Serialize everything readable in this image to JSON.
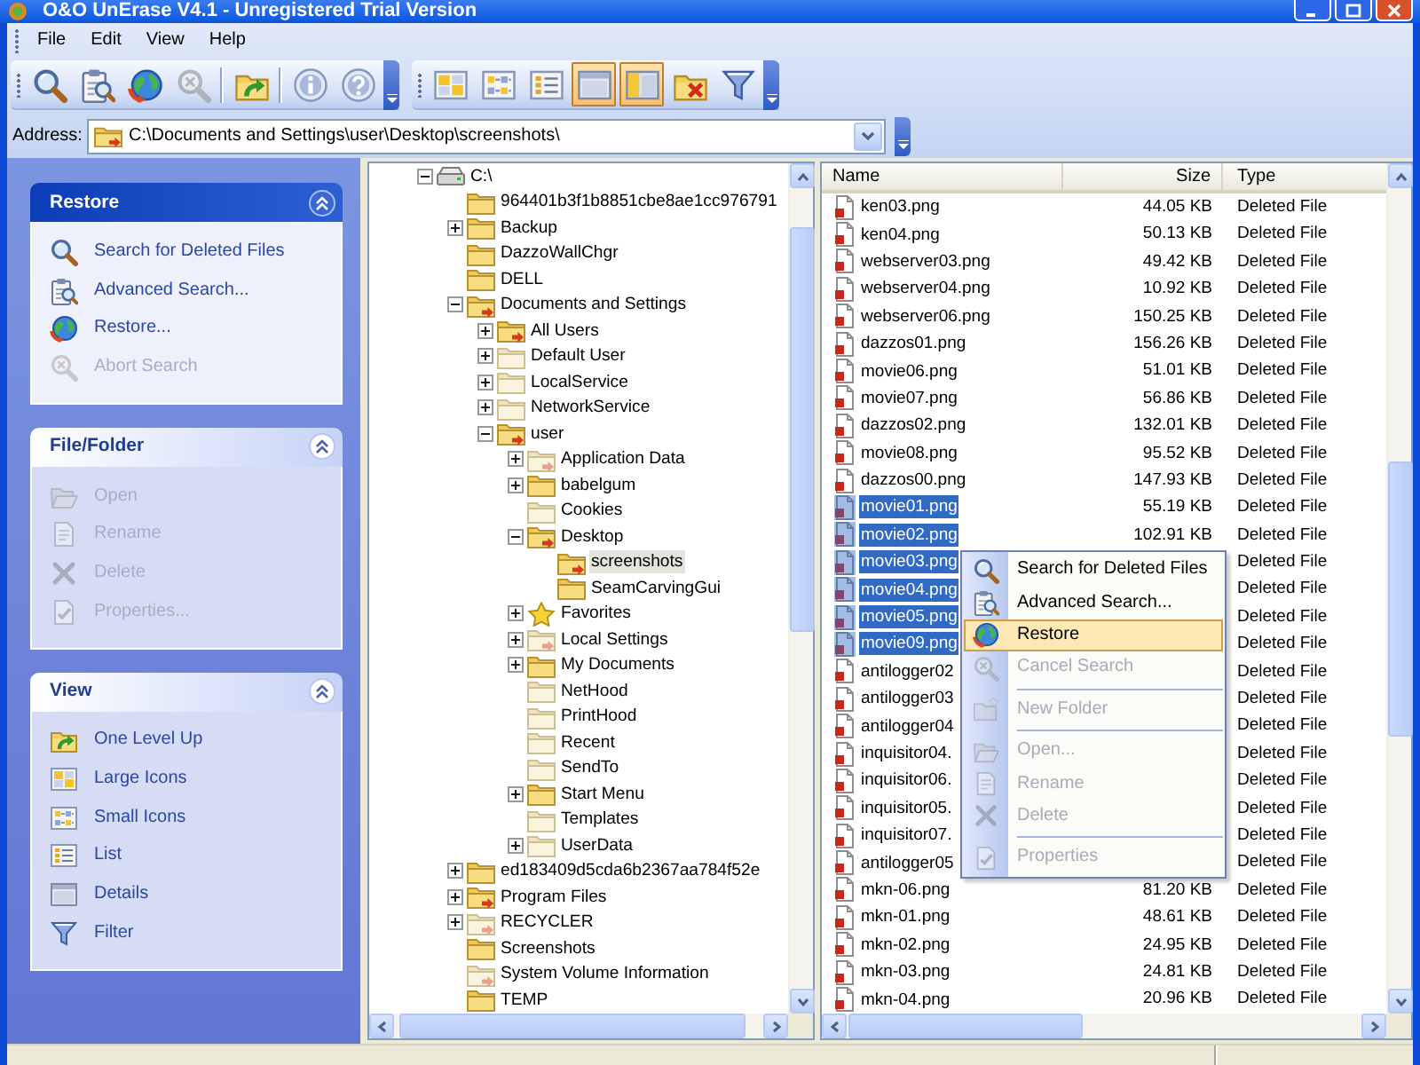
{
  "window": {
    "title": "O&O UnErase V4.1 - Unregistered Trial Version"
  },
  "menu_bar": [
    "File",
    "Edit",
    "View",
    "Help"
  ],
  "toolbars": [
    {
      "buttons": [
        {
          "kind": "button",
          "pressed": false,
          "disabled": false
        },
        {
          "kind": "button",
          "pressed": false,
          "disabled": false
        },
        {
          "kind": "button",
          "pressed": false,
          "disabled": false
        },
        {
          "kind": "button",
          "pressed": false,
          "disabled": true
        },
        {
          "kind": "separator"
        },
        {
          "kind": "button",
          "pressed": false,
          "disabled": false
        },
        {
          "kind": "separator"
        },
        {
          "kind": "button",
          "pressed": false,
          "disabled": false
        },
        {
          "kind": "button",
          "pressed": false,
          "disabled": false
        }
      ]
    },
    {
      "buttons": [
        {
          "kind": "button",
          "pressed": false,
          "disabled": false
        },
        {
          "kind": "button",
          "pressed": false,
          "disabled": false
        },
        {
          "kind": "button",
          "pressed": false,
          "disabled": false
        },
        {
          "kind": "button",
          "pressed": true,
          "disabled": false
        },
        {
          "kind": "button",
          "pressed": true,
          "disabled": false
        },
        {
          "kind": "button",
          "pressed": false,
          "disabled": false
        },
        {
          "kind": "button",
          "pressed": false,
          "disabled": false
        }
      ]
    }
  ],
  "address_bar": {
    "label": "Address:",
    "value": "C:\\Documents and Settings\\user\\Desktop\\screenshots\\"
  },
  "task_panels": [
    {
      "title": "Restore",
      "emphasized": true,
      "expanded": true,
      "items": [
        {
          "label": "Search for Deleted Files",
          "disabled": false
        },
        {
          "label": "Advanced Search...",
          "disabled": false
        },
        {
          "label": "Restore...",
          "disabled": false
        },
        {
          "label": "Abort Search",
          "disabled": true
        }
      ]
    },
    {
      "title": "File/Folder",
      "emphasized": false,
      "expanded": true,
      "items": [
        {
          "label": "Open",
          "disabled": true
        },
        {
          "label": "Rename",
          "disabled": true
        },
        {
          "label": "Delete",
          "disabled": true
        },
        {
          "label": "Properties...",
          "disabled": true
        }
      ]
    },
    {
      "title": "View",
      "emphasized": false,
      "expanded": true,
      "items": [
        {
          "label": "One Level Up",
          "disabled": false
        },
        {
          "label": "Large Icons",
          "disabled": false
        },
        {
          "label": "Small Icons",
          "disabled": false
        },
        {
          "label": "List",
          "disabled": false
        },
        {
          "label": "Details",
          "disabled": false
        },
        {
          "label": "Filter",
          "disabled": false
        }
      ]
    }
  ],
  "folder_tree": [
    {
      "label": "C:\\",
      "kind": "drive",
      "expanded": true,
      "selected": false,
      "children": [
        {
          "label": "964401b3f1b8851cbe8ae1cc976791",
          "kind": "folder",
          "selected": false
        },
        {
          "label": "Backup",
          "kind": "folder",
          "expanded": false,
          "selected": false
        },
        {
          "label": "DazzoWallChgr",
          "kind": "folder",
          "selected": false
        },
        {
          "label": "DELL",
          "kind": "folder",
          "selected": false
        },
        {
          "label": "Documents and Settings",
          "kind": "folder-marked",
          "expanded": true,
          "selected": false,
          "children": [
            {
              "label": "All Users",
              "kind": "folder-marked",
              "expanded": false,
              "selected": false
            },
            {
              "label": "Default User",
              "kind": "folder-pale",
              "expanded": false,
              "selected": false
            },
            {
              "label": "LocalService",
              "kind": "folder-pale",
              "expanded": false,
              "selected": false
            },
            {
              "label": "NetworkService",
              "kind": "folder-pale",
              "expanded": false,
              "selected": false
            },
            {
              "label": "user",
              "kind": "folder-marked",
              "expanded": true,
              "selected": false,
              "children": [
                {
                  "label": "Application Data",
                  "kind": "folder-pale-marked",
                  "expanded": false,
                  "selected": false
                },
                {
                  "label": "babelgum",
                  "kind": "folder",
                  "expanded": false,
                  "selected": false
                },
                {
                  "label": "Cookies",
                  "kind": "folder-pale",
                  "selected": false
                },
                {
                  "label": "Desktop",
                  "kind": "folder-marked",
                  "expanded": true,
                  "selected": false,
                  "children": [
                    {
                      "label": "screenshots",
                      "kind": "folder-marked",
                      "selected": true
                    },
                    {
                      "label": "SeamCarvingGui",
                      "kind": "folder",
                      "selected": false
                    }
                  ]
                },
                {
                  "label": "Favorites",
                  "kind": "star",
                  "expanded": false,
                  "selected": false
                },
                {
                  "label": "Local Settings",
                  "kind": "folder-pale-marked",
                  "expanded": false,
                  "selected": false
                },
                {
                  "label": "My Documents",
                  "kind": "folder",
                  "expanded": false,
                  "selected": false
                },
                {
                  "label": "NetHood",
                  "kind": "folder-pale",
                  "selected": false
                },
                {
                  "label": "PrintHood",
                  "kind": "folder-pale",
                  "selected": false
                },
                {
                  "label": "Recent",
                  "kind": "folder-pale",
                  "selected": false
                },
                {
                  "label": "SendTo",
                  "kind": "folder-pale",
                  "selected": false
                },
                {
                  "label": "Start Menu",
                  "kind": "folder",
                  "expanded": false,
                  "selected": false
                },
                {
                  "label": "Templates",
                  "kind": "folder-pale",
                  "selected": false
                },
                {
                  "label": "UserData",
                  "kind": "folder-pale",
                  "expanded": false,
                  "selected": false
                }
              ]
            }
          ]
        },
        {
          "label": "ed183409d5cda6b2367aa784f52e",
          "kind": "folder",
          "expanded": false,
          "selected": false
        },
        {
          "label": "Program Files",
          "kind": "folder-marked",
          "expanded": false,
          "selected": false
        },
        {
          "label": "RECYCLER",
          "kind": "folder-pale-marked",
          "expanded": false,
          "selected": false
        },
        {
          "label": "Screenshots",
          "kind": "folder",
          "selected": false
        },
        {
          "label": "System Volume Information",
          "kind": "folder-pale-marked",
          "selected": false
        },
        {
          "label": "TEMP",
          "kind": "folder",
          "selected": false
        }
      ]
    }
  ],
  "file_list": {
    "columns": [
      "Name",
      "Size",
      "Type"
    ],
    "rows": [
      {
        "name": "ken03.png",
        "size": "44.05 KB",
        "type": "Deleted File",
        "selected": false
      },
      {
        "name": "ken04.png",
        "size": "50.13 KB",
        "type": "Deleted File",
        "selected": false
      },
      {
        "name": "webserver03.png",
        "size": "49.42 KB",
        "type": "Deleted File",
        "selected": false
      },
      {
        "name": "webserver04.png",
        "size": "10.92 KB",
        "type": "Deleted File",
        "selected": false
      },
      {
        "name": "webserver06.png",
        "size": "150.25 KB",
        "type": "Deleted File",
        "selected": false
      },
      {
        "name": "dazzos01.png",
        "size": "156.26 KB",
        "type": "Deleted File",
        "selected": false
      },
      {
        "name": "movie06.png",
        "size": "51.01 KB",
        "type": "Deleted File",
        "selected": false
      },
      {
        "name": "movie07.png",
        "size": "56.86 KB",
        "type": "Deleted File",
        "selected": false
      },
      {
        "name": "dazzos02.png",
        "size": "132.01 KB",
        "type": "Deleted File",
        "selected": false
      },
      {
        "name": "movie08.png",
        "size": "95.52 KB",
        "type": "Deleted File",
        "selected": false
      },
      {
        "name": "dazzos00.png",
        "size": "147.93 KB",
        "type": "Deleted File",
        "selected": false
      },
      {
        "name": "movie01.png",
        "size": "55.19 KB",
        "type": "Deleted File",
        "selected": true
      },
      {
        "name": "movie02.png",
        "size": "102.91 KB",
        "type": "Deleted File",
        "selected": true
      },
      {
        "name": "movie03.png",
        "type": "Deleted File",
        "selected": true
      },
      {
        "name": "movie04.png",
        "type": "Deleted File",
        "selected": true
      },
      {
        "name": "movie05.png",
        "type": "Deleted File",
        "selected": true
      },
      {
        "name": "movie09.png",
        "type": "Deleted File",
        "selected": true
      },
      {
        "name": "antilogger02",
        "type": "Deleted File",
        "selected": false
      },
      {
        "name": "antilogger03",
        "type": "Deleted File",
        "selected": false
      },
      {
        "name": "antilogger04",
        "type": "Deleted File",
        "selected": false
      },
      {
        "name": "inquisitor04.",
        "type": "Deleted File",
        "selected": false
      },
      {
        "name": "inquisitor06.",
        "type": "Deleted File",
        "selected": false
      },
      {
        "name": "inquisitor05.",
        "type": "Deleted File",
        "selected": false
      },
      {
        "name": "inquisitor07.",
        "type": "Deleted File",
        "selected": false
      },
      {
        "name": "antilogger05",
        "type": "Deleted File",
        "selected": false
      },
      {
        "name": "mkn-06.png",
        "size": "81.20 KB",
        "type": "Deleted File",
        "selected": false
      },
      {
        "name": "mkn-01.png",
        "size": "48.61 KB",
        "type": "Deleted File",
        "selected": false
      },
      {
        "name": "mkn-02.png",
        "size": "24.95 KB",
        "type": "Deleted File",
        "selected": false
      },
      {
        "name": "mkn-03.png",
        "size": "24.81 KB",
        "type": "Deleted File",
        "selected": false
      },
      {
        "name": "mkn-04.png",
        "size": "20.96 KB",
        "type": "Deleted File",
        "selected": false
      }
    ]
  },
  "context_menu": {
    "items": [
      {
        "kind": "item",
        "label": "Search for Deleted Files",
        "disabled": false,
        "selected": false
      },
      {
        "kind": "item",
        "label": "Advanced Search...",
        "disabled": false,
        "selected": false
      },
      {
        "kind": "item",
        "label": "Restore",
        "disabled": false,
        "selected": true
      },
      {
        "kind": "item",
        "label": "Cancel Search",
        "disabled": true,
        "selected": false
      },
      {
        "kind": "separator"
      },
      {
        "kind": "item",
        "label": "New Folder",
        "disabled": true,
        "selected": false
      },
      {
        "kind": "separator"
      },
      {
        "kind": "item",
        "label": "Open...",
        "disabled": true,
        "selected": false
      },
      {
        "kind": "item",
        "label": "Rename",
        "disabled": true,
        "selected": false
      },
      {
        "kind": "item",
        "label": "Delete",
        "disabled": true,
        "selected": false
      },
      {
        "kind": "separator"
      },
      {
        "kind": "item",
        "label": "Properties",
        "disabled": true,
        "selected": false
      }
    ]
  }
}
